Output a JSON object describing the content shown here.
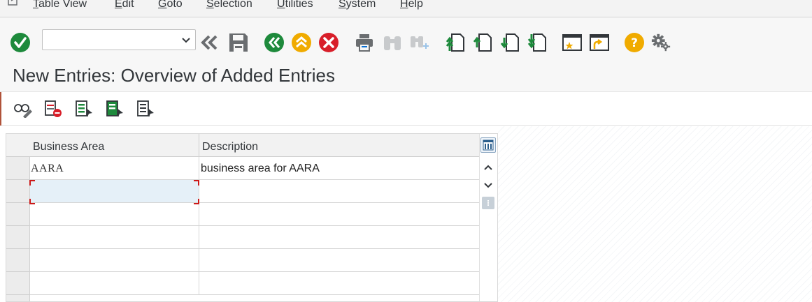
{
  "menu": {
    "items": [
      {
        "underline": "T",
        "rest": "able View"
      },
      {
        "underline": "E",
        "rest": "dit"
      },
      {
        "underline": "G",
        "rest": "oto"
      },
      {
        "underline": "S",
        "rest": "election"
      },
      {
        "underline": "U",
        "rest": "tilities"
      },
      {
        "underline": "S",
        "rest": "ystem"
      },
      {
        "underline": "H",
        "rest": "elp"
      }
    ]
  },
  "toolbar": {
    "command_value": "",
    "icons": [
      "enter-icon",
      "back-double-icon",
      "save-icon",
      "back-icon",
      "exit-icon",
      "cancel-icon",
      "print-icon",
      "find-icon",
      "find-next-icon",
      "first-page-icon",
      "previous-page-icon",
      "next-page-icon",
      "last-page-icon",
      "create-session-icon",
      "shortcut-icon",
      "help-icon",
      "customize-icon"
    ]
  },
  "page": {
    "title": "New Entries: Overview of Added Entries"
  },
  "app_toolbar": {
    "icons": [
      "display-change-icon",
      "delete-icon",
      "select-all-icon",
      "select-block-icon",
      "deselect-all-icon"
    ]
  },
  "table": {
    "columns": [
      "Business Area",
      "Description"
    ],
    "rows": [
      {
        "business_area": "AARA",
        "description": "business area for AARA"
      },
      {
        "business_area": "",
        "description": ""
      },
      {
        "business_area": "",
        "description": ""
      },
      {
        "business_area": "",
        "description": ""
      },
      {
        "business_area": "",
        "description": ""
      },
      {
        "business_area": "",
        "description": ""
      }
    ]
  },
  "colors": {
    "accent_green": "#1e8a3c",
    "accent_orange": "#f0ab00",
    "accent_red": "#d81f2a",
    "focus_bracket": "#cc1919"
  }
}
